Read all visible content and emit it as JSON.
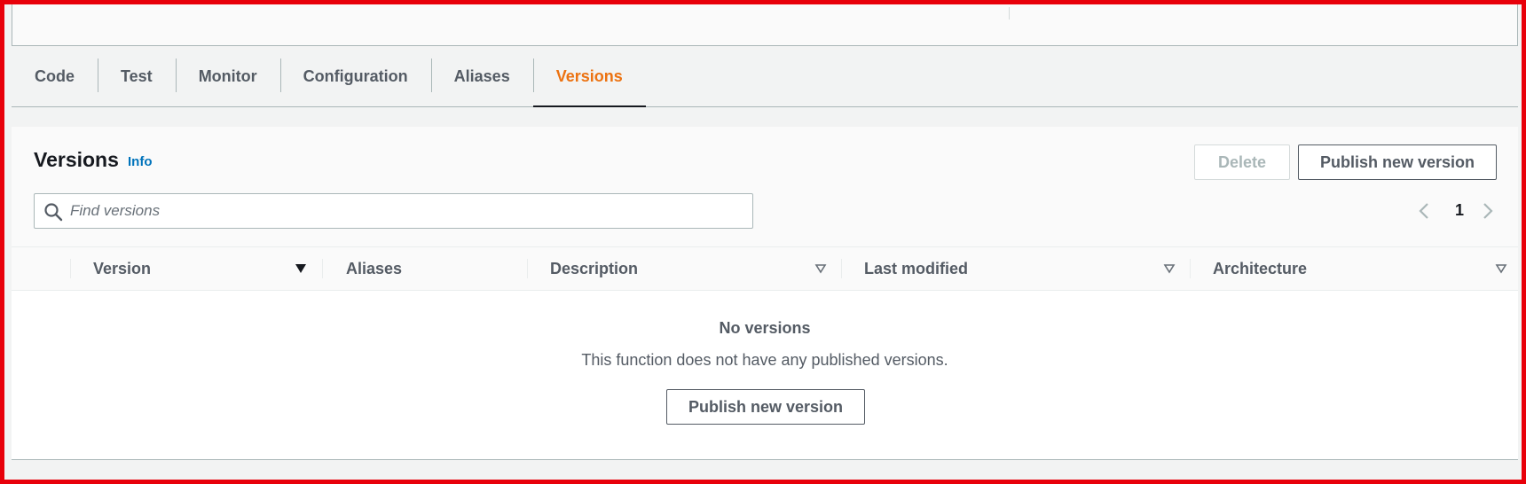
{
  "tabs": [
    {
      "label": "Code",
      "active": false
    },
    {
      "label": "Test",
      "active": false
    },
    {
      "label": "Monitor",
      "active": false
    },
    {
      "label": "Configuration",
      "active": false
    },
    {
      "label": "Aliases",
      "active": false
    },
    {
      "label": "Versions",
      "active": true
    }
  ],
  "panel": {
    "title": "Versions",
    "info_label": "Info",
    "delete_label": "Delete",
    "publish_label": "Publish new version"
  },
  "search": {
    "placeholder": "Find versions",
    "value": ""
  },
  "pagination": {
    "current_page": "1"
  },
  "table": {
    "columns": [
      "Version",
      "Aliases",
      "Description",
      "Last modified",
      "Architecture"
    ]
  },
  "empty_state": {
    "title": "No versions",
    "description": "This function does not have any published versions.",
    "button_label": "Publish new version"
  },
  "colors": {
    "accent": "#ec7211",
    "link": "#0073bb",
    "frame": "#e8000a"
  },
  "icons": {
    "search": "search-icon",
    "prev": "chevron-left-icon",
    "next": "chevron-right-icon",
    "sort_active": "caret-down-filled-icon",
    "sort": "caret-down-outline-icon"
  }
}
